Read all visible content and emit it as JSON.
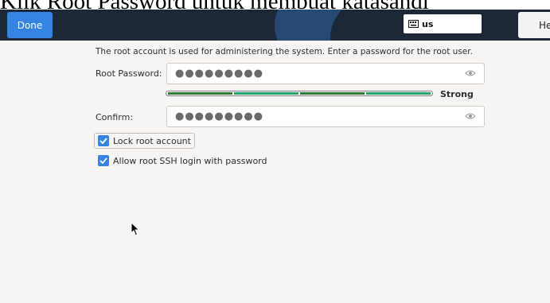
{
  "caption": "Klik Root Password untuk membuat katasandi",
  "header": {
    "done_label": "Done",
    "keyboard_layout": "us",
    "help_label": "Help"
  },
  "main": {
    "description": "The root account is used for administering the system.  Enter a password for the root user.",
    "root_password_label": "Root Password:",
    "root_password_value": "●●●●●●●●●",
    "strength_label": "Strong",
    "strength_fraction": 1.0,
    "confirm_label": "Confirm:",
    "confirm_value": "●●●●●●●●●",
    "lock_root_label": "Lock root account",
    "lock_root_checked": true,
    "allow_ssh_label": "Allow root SSH login with password",
    "allow_ssh_checked": true
  },
  "colors": {
    "header_bg": "#1c2838",
    "accent": "#3584e4",
    "strength": "#26a269"
  }
}
